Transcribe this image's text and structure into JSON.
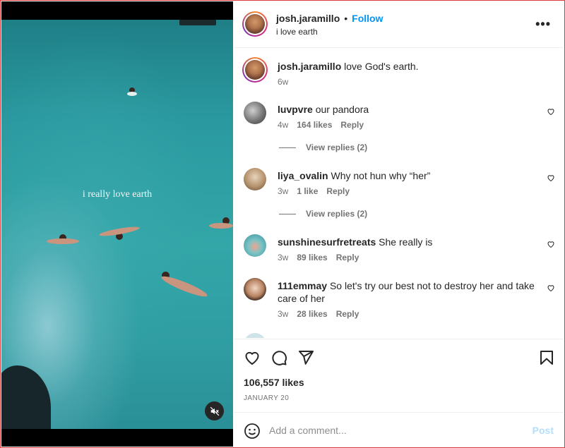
{
  "video": {
    "caption": "i really love earth"
  },
  "header": {
    "username": "josh.jaramillo",
    "separator": "•",
    "follow_label": "Follow",
    "subtitle": "i love earth",
    "more_label": "•••"
  },
  "caption_post": {
    "username": "josh.jaramillo",
    "text": "love God's earth.",
    "age": "6w"
  },
  "comments": [
    {
      "username": "luvpvre",
      "text": "our pandora",
      "age": "4w",
      "likes": "164 likes",
      "reply": "Reply",
      "view_replies": "View replies (2)"
    },
    {
      "username": "liya_ovalin",
      "text": "Why not hun why “her”",
      "age": "3w",
      "likes": "1 like",
      "reply": "Reply",
      "view_replies": "View replies (2)"
    },
    {
      "username": "sunshinesurfretreats",
      "text": "She really is",
      "age": "3w",
      "likes": "89 likes",
      "reply": "Reply"
    },
    {
      "username": "111emmay",
      "text": "So let's try our best not to destroy her and take care of her",
      "age": "3w",
      "likes": "28 likes",
      "reply": "Reply"
    }
  ],
  "stats": {
    "likes": "106,557 likes",
    "date": "JANUARY 20"
  },
  "composer": {
    "placeholder": "Add a comment...",
    "post_label": "Post"
  },
  "colors": {
    "accent": "#0095f6",
    "post_disabled": "#b2dffc",
    "frame_border": "#d93a3a"
  },
  "icons": [
    "heart-icon",
    "comment-icon",
    "share-icon",
    "bookmark-icon",
    "emoji-icon",
    "mute-icon",
    "more-icon"
  ]
}
